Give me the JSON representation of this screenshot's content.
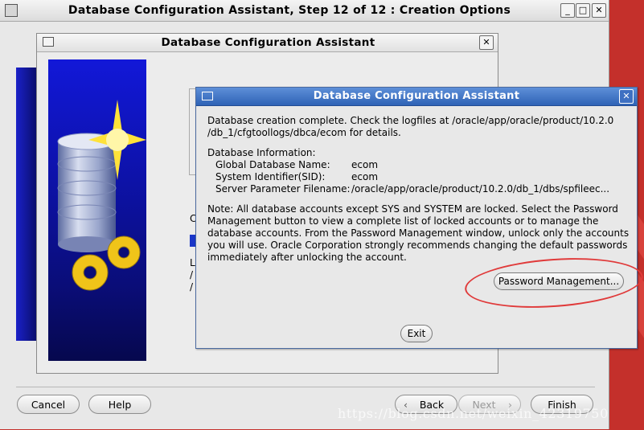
{
  "main_window": {
    "title": "Database Configuration Assistant, Step 12 of 12 : Creation Options",
    "controls": {
      "minimize": "_",
      "maximize": "□",
      "close": "✕"
    },
    "buttons": {
      "cancel": "Cancel",
      "help": "Help",
      "back": "Back",
      "next": "Next",
      "finish": "Finish"
    }
  },
  "behind_dialog": {
    "title": "Database Configuration Assistant",
    "close": "✕",
    "partial_labels": [
      "C",
      "L",
      "/",
      "/"
    ]
  },
  "dialog": {
    "title": "Database Configuration Assistant",
    "close": "✕",
    "message_line1": "Database creation complete. Check the logfiles at /oracle/app/oracle/product/10.2.0",
    "message_line2": "/db_1/cfgtoollogs/dbca/ecom for details.",
    "info_heading": "Database Information:",
    "info": [
      {
        "label": "Global Database Name:",
        "value": "ecom"
      },
      {
        "label": "System Identifier(SID):",
        "value": "ecom"
      },
      {
        "label": "Server Parameter Filename:",
        "value": "/oracle/app/oracle/product/10.2.0/db_1/dbs/spfileec..."
      }
    ],
    "note_lines": [
      "Note: All database accounts except SYS and SYSTEM are locked. Select the Password",
      "Management button to view a complete list of locked accounts or to manage the",
      "database accounts. From the Password Management window, unlock only the accounts",
      "you will use. Oracle Corporation strongly recommends changing the default passwords",
      "immediately after unlocking the account."
    ],
    "password_button": "Password Management...",
    "exit_button": "Exit"
  },
  "watermark": "https://blog.csdn.net/weixin_42319750",
  "colors": {
    "accent": "#2f63b6",
    "highlight": "#e03a3a",
    "desktop": "#c4302b"
  }
}
